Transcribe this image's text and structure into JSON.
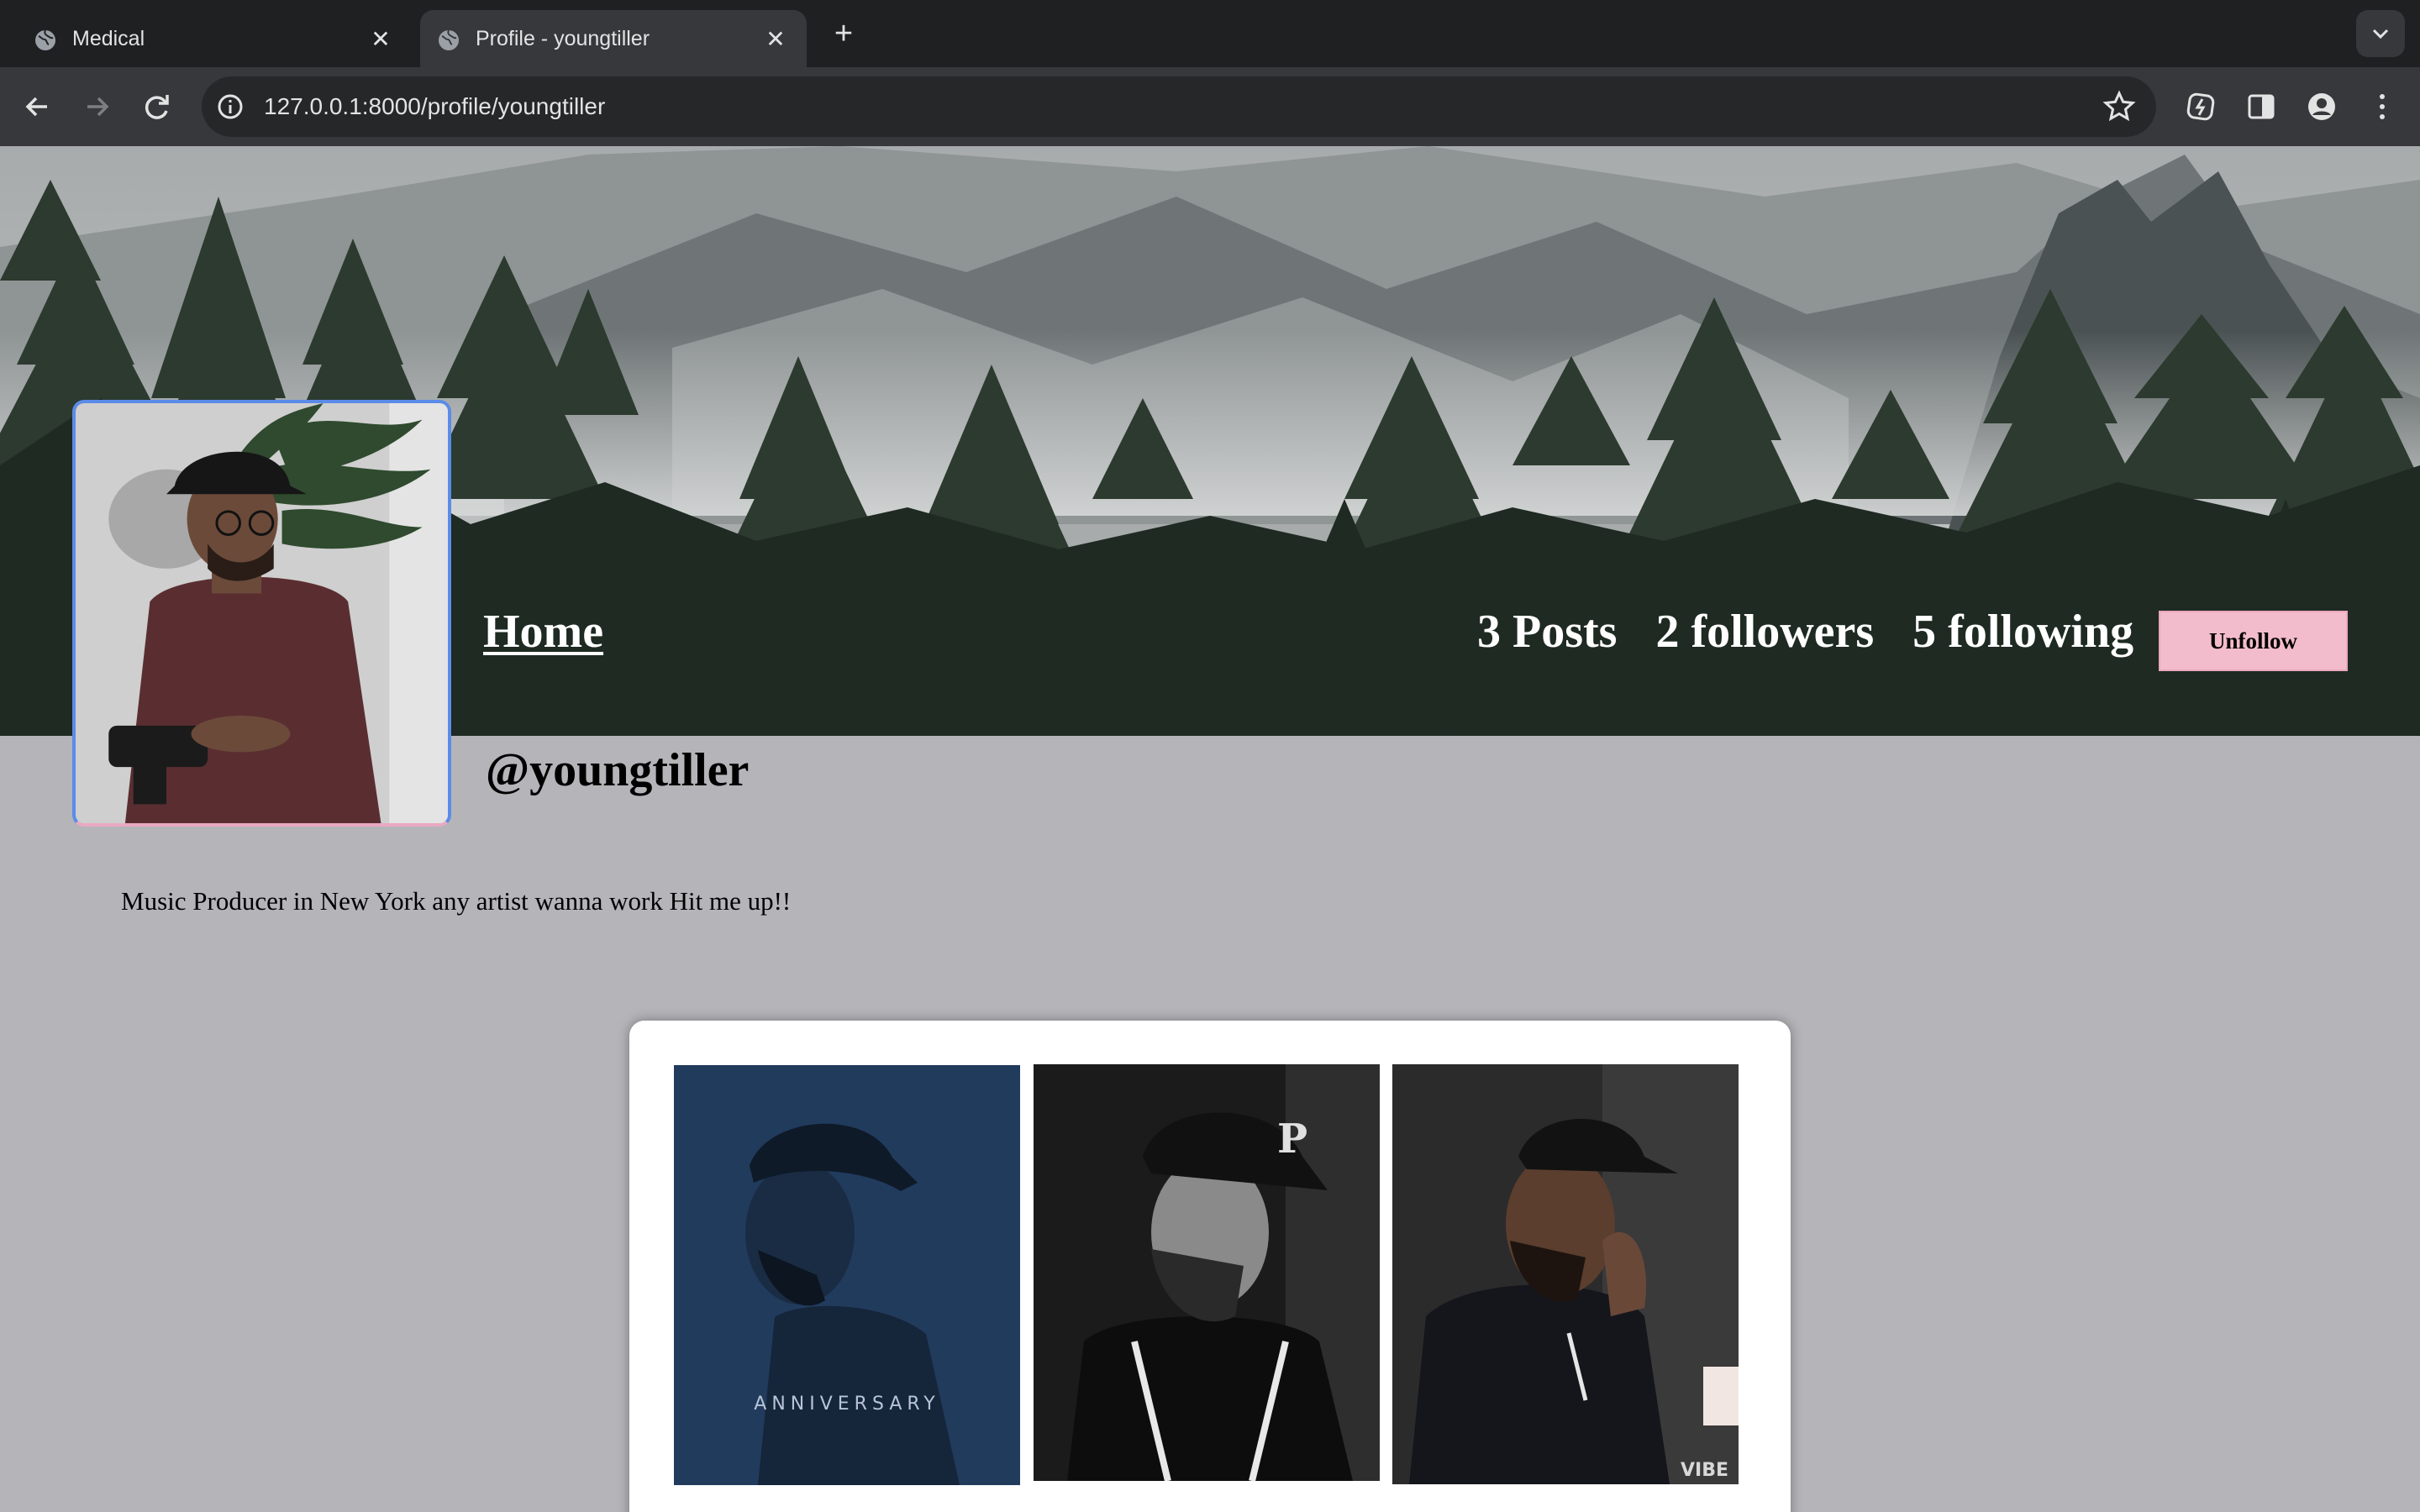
{
  "browser": {
    "tabs": [
      {
        "title": "Medical",
        "icon": "globe-icon"
      },
      {
        "title": "Profile - youngtiller",
        "icon": "globe-icon"
      }
    ],
    "url": "127.0.0.1:8000/profile/youngtiller"
  },
  "profile": {
    "home_label": "Home",
    "posts_label": "3 Posts",
    "followers_label": "2 followers",
    "following_label": "5 following",
    "unfollow_label": "Unfollow",
    "username": "@youngtiller",
    "bio": "Music Producer in New York any artist wanna work Hit me up!!"
  },
  "posts": [
    {
      "caption": "ANNIVERSARY"
    },
    {
      "caption": ""
    },
    {
      "caption": "VIBE"
    }
  ],
  "colors": {
    "page_background": "#b4b4b9",
    "unfollow_button": "#f3bccc",
    "chrome_dark": "#1f2022",
    "chrome_toolbar": "#37383b"
  }
}
